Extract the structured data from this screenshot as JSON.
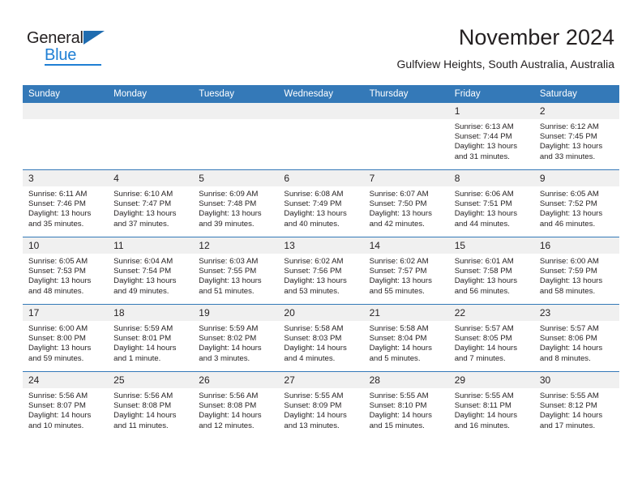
{
  "brand": {
    "name_part1": "General",
    "name_part2": "Blue"
  },
  "header": {
    "month_title": "November 2024",
    "location": "Gulfview Heights, South Australia, Australia"
  },
  "colors": {
    "header_blue": "#3479b8",
    "logo_blue": "#1f7fd4",
    "daynum_band": "#f0f0f0"
  },
  "weekdays": [
    "Sunday",
    "Monday",
    "Tuesday",
    "Wednesday",
    "Thursday",
    "Friday",
    "Saturday"
  ],
  "weeks": [
    [
      {
        "day": "",
        "empty": true,
        "sunrise": "",
        "sunset": "",
        "daylight": ""
      },
      {
        "day": "",
        "empty": true,
        "sunrise": "",
        "sunset": "",
        "daylight": ""
      },
      {
        "day": "",
        "empty": true,
        "sunrise": "",
        "sunset": "",
        "daylight": ""
      },
      {
        "day": "",
        "empty": true,
        "sunrise": "",
        "sunset": "",
        "daylight": ""
      },
      {
        "day": "",
        "empty": true,
        "sunrise": "",
        "sunset": "",
        "daylight": ""
      },
      {
        "day": "1",
        "sunrise": "Sunrise: 6:13 AM",
        "sunset": "Sunset: 7:44 PM",
        "daylight": "Daylight: 13 hours and 31 minutes."
      },
      {
        "day": "2",
        "sunrise": "Sunrise: 6:12 AM",
        "sunset": "Sunset: 7:45 PM",
        "daylight": "Daylight: 13 hours and 33 minutes."
      }
    ],
    [
      {
        "day": "3",
        "sunrise": "Sunrise: 6:11 AM",
        "sunset": "Sunset: 7:46 PM",
        "daylight": "Daylight: 13 hours and 35 minutes."
      },
      {
        "day": "4",
        "sunrise": "Sunrise: 6:10 AM",
        "sunset": "Sunset: 7:47 PM",
        "daylight": "Daylight: 13 hours and 37 minutes."
      },
      {
        "day": "5",
        "sunrise": "Sunrise: 6:09 AM",
        "sunset": "Sunset: 7:48 PM",
        "daylight": "Daylight: 13 hours and 39 minutes."
      },
      {
        "day": "6",
        "sunrise": "Sunrise: 6:08 AM",
        "sunset": "Sunset: 7:49 PM",
        "daylight": "Daylight: 13 hours and 40 minutes."
      },
      {
        "day": "7",
        "sunrise": "Sunrise: 6:07 AM",
        "sunset": "Sunset: 7:50 PM",
        "daylight": "Daylight: 13 hours and 42 minutes."
      },
      {
        "day": "8",
        "sunrise": "Sunrise: 6:06 AM",
        "sunset": "Sunset: 7:51 PM",
        "daylight": "Daylight: 13 hours and 44 minutes."
      },
      {
        "day": "9",
        "sunrise": "Sunrise: 6:05 AM",
        "sunset": "Sunset: 7:52 PM",
        "daylight": "Daylight: 13 hours and 46 minutes."
      }
    ],
    [
      {
        "day": "10",
        "sunrise": "Sunrise: 6:05 AM",
        "sunset": "Sunset: 7:53 PM",
        "daylight": "Daylight: 13 hours and 48 minutes."
      },
      {
        "day": "11",
        "sunrise": "Sunrise: 6:04 AM",
        "sunset": "Sunset: 7:54 PM",
        "daylight": "Daylight: 13 hours and 49 minutes."
      },
      {
        "day": "12",
        "sunrise": "Sunrise: 6:03 AM",
        "sunset": "Sunset: 7:55 PM",
        "daylight": "Daylight: 13 hours and 51 minutes."
      },
      {
        "day": "13",
        "sunrise": "Sunrise: 6:02 AM",
        "sunset": "Sunset: 7:56 PM",
        "daylight": "Daylight: 13 hours and 53 minutes."
      },
      {
        "day": "14",
        "sunrise": "Sunrise: 6:02 AM",
        "sunset": "Sunset: 7:57 PM",
        "daylight": "Daylight: 13 hours and 55 minutes."
      },
      {
        "day": "15",
        "sunrise": "Sunrise: 6:01 AM",
        "sunset": "Sunset: 7:58 PM",
        "daylight": "Daylight: 13 hours and 56 minutes."
      },
      {
        "day": "16",
        "sunrise": "Sunrise: 6:00 AM",
        "sunset": "Sunset: 7:59 PM",
        "daylight": "Daylight: 13 hours and 58 minutes."
      }
    ],
    [
      {
        "day": "17",
        "sunrise": "Sunrise: 6:00 AM",
        "sunset": "Sunset: 8:00 PM",
        "daylight": "Daylight: 13 hours and 59 minutes."
      },
      {
        "day": "18",
        "sunrise": "Sunrise: 5:59 AM",
        "sunset": "Sunset: 8:01 PM",
        "daylight": "Daylight: 14 hours and 1 minute."
      },
      {
        "day": "19",
        "sunrise": "Sunrise: 5:59 AM",
        "sunset": "Sunset: 8:02 PM",
        "daylight": "Daylight: 14 hours and 3 minutes."
      },
      {
        "day": "20",
        "sunrise": "Sunrise: 5:58 AM",
        "sunset": "Sunset: 8:03 PM",
        "daylight": "Daylight: 14 hours and 4 minutes."
      },
      {
        "day": "21",
        "sunrise": "Sunrise: 5:58 AM",
        "sunset": "Sunset: 8:04 PM",
        "daylight": "Daylight: 14 hours and 5 minutes."
      },
      {
        "day": "22",
        "sunrise": "Sunrise: 5:57 AM",
        "sunset": "Sunset: 8:05 PM",
        "daylight": "Daylight: 14 hours and 7 minutes."
      },
      {
        "day": "23",
        "sunrise": "Sunrise: 5:57 AM",
        "sunset": "Sunset: 8:06 PM",
        "daylight": "Daylight: 14 hours and 8 minutes."
      }
    ],
    [
      {
        "day": "24",
        "sunrise": "Sunrise: 5:56 AM",
        "sunset": "Sunset: 8:07 PM",
        "daylight": "Daylight: 14 hours and 10 minutes."
      },
      {
        "day": "25",
        "sunrise": "Sunrise: 5:56 AM",
        "sunset": "Sunset: 8:08 PM",
        "daylight": "Daylight: 14 hours and 11 minutes."
      },
      {
        "day": "26",
        "sunrise": "Sunrise: 5:56 AM",
        "sunset": "Sunset: 8:08 PM",
        "daylight": "Daylight: 14 hours and 12 minutes."
      },
      {
        "day": "27",
        "sunrise": "Sunrise: 5:55 AM",
        "sunset": "Sunset: 8:09 PM",
        "daylight": "Daylight: 14 hours and 13 minutes."
      },
      {
        "day": "28",
        "sunrise": "Sunrise: 5:55 AM",
        "sunset": "Sunset: 8:10 PM",
        "daylight": "Daylight: 14 hours and 15 minutes."
      },
      {
        "day": "29",
        "sunrise": "Sunrise: 5:55 AM",
        "sunset": "Sunset: 8:11 PM",
        "daylight": "Daylight: 14 hours and 16 minutes."
      },
      {
        "day": "30",
        "sunrise": "Sunrise: 5:55 AM",
        "sunset": "Sunset: 8:12 PM",
        "daylight": "Daylight: 14 hours and 17 minutes."
      }
    ]
  ]
}
